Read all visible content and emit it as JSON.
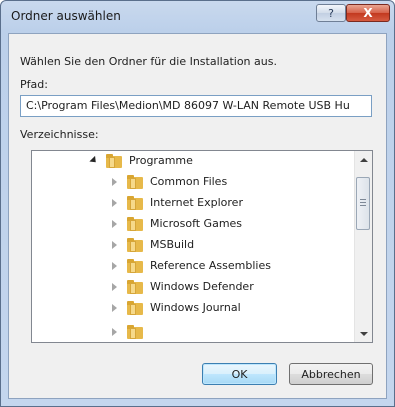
{
  "window": {
    "title": "Ordner auswählen",
    "help_glyph": "?",
    "close_glyph": "X"
  },
  "dialog": {
    "instruction": "Wählen Sie den Ordner für die Installation aus.",
    "path_label": "Pfad:",
    "path_value": "C:\\Program Files\\Medion\\MD 86097 W-LAN Remote USB Hu",
    "dirs_label": "Verzeichnisse:"
  },
  "tree": {
    "items": [
      {
        "label": "Programme",
        "expanded": true,
        "level": 0
      },
      {
        "label": "Common Files",
        "expanded": false,
        "level": 1
      },
      {
        "label": "Internet Explorer",
        "expanded": false,
        "level": 1
      },
      {
        "label": "Microsoft Games",
        "expanded": false,
        "level": 1
      },
      {
        "label": "MSBuild",
        "expanded": false,
        "level": 1
      },
      {
        "label": "Reference Assemblies",
        "expanded": false,
        "level": 1
      },
      {
        "label": "Windows Defender",
        "expanded": false,
        "level": 1
      },
      {
        "label": "Windows Journal",
        "expanded": false,
        "level": 1
      }
    ]
  },
  "buttons": {
    "ok": "OK",
    "cancel": "Abbrechen"
  },
  "colors": {
    "title_gradient": "#c4d6ee",
    "close_red": "#c2391f",
    "folder_yellow": "#e7b94a",
    "default_button_blue": "#a7d9f5"
  }
}
